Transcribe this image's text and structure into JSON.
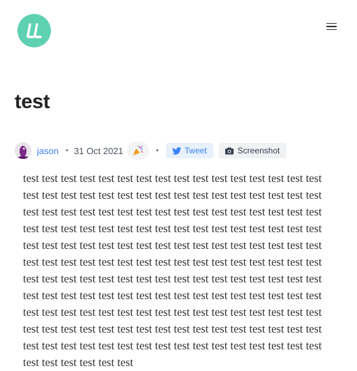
{
  "header": {
    "logo_icon": "brand-logo-icon",
    "logo_color": "#5fd1b3",
    "menu_icon": "hamburger-menu-icon"
  },
  "post": {
    "title": "test",
    "author": "jason",
    "date": "31 Oct 2021",
    "reaction_icon": "party-popper-icon",
    "tweet_label": "Tweet",
    "screenshot_label": "Screenshot",
    "accent_color": "#3b82f6",
    "body": "test test test test test test test test test test test test test test test test test test test test test test test test test test test test test test test test test test test test test test test test test test test test test test test test test test test test test test test test test test test test test test test test test test test test test test test test test test test test test test test test test test test test test test test test test test test test test test test test test test test test test test test test test test test test test test test test test test test test test test test test test test test test test test test test test test test test test test test test test test test test test test test test test test test test test test test test test test test test test test test test test test test test test test test test test test test test test test test test test test test test test test"
  }
}
